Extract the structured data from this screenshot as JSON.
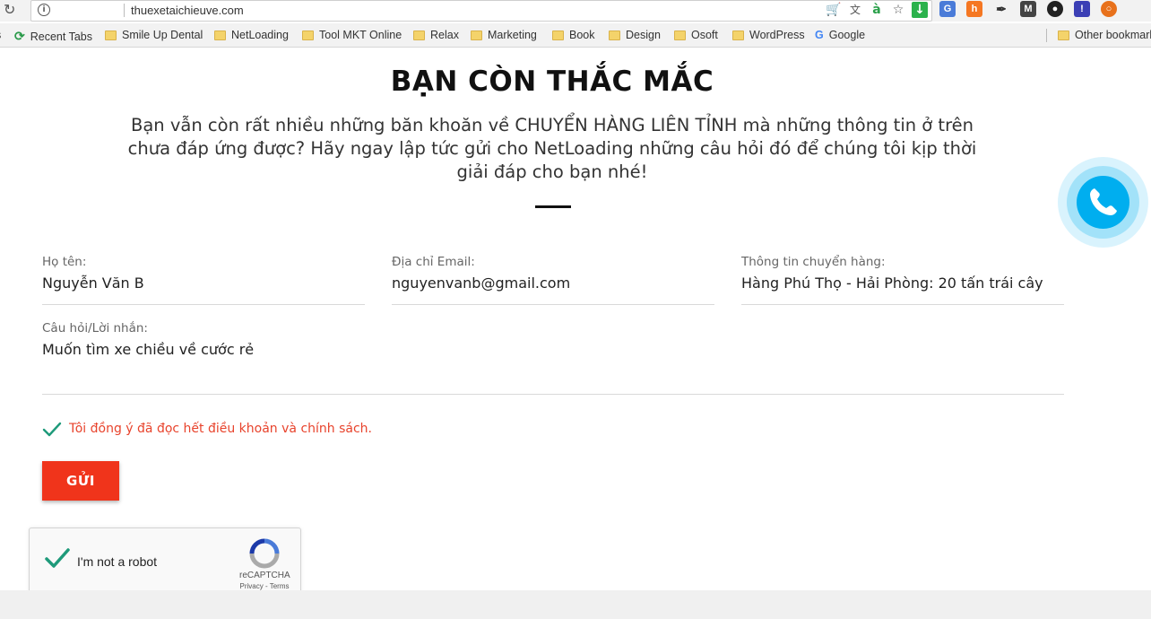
{
  "browser": {
    "url": "thuexetaichieuve.com",
    "bookmarks": [
      {
        "label": "Recent Tabs",
        "icon": "recent-tabs-icon"
      },
      {
        "label": "Smile Up Dental",
        "icon": "folder-icon"
      },
      {
        "label": "NetLoading",
        "icon": "folder-icon"
      },
      {
        "label": "Tool MKT Online",
        "icon": "folder-icon"
      },
      {
        "label": "Relax",
        "icon": "folder-icon"
      },
      {
        "label": "Marketing",
        "icon": "folder-icon"
      },
      {
        "label": "Book",
        "icon": "folder-icon"
      },
      {
        "label": "Design",
        "icon": "folder-icon"
      },
      {
        "label": "Osoft",
        "icon": "folder-icon"
      },
      {
        "label": "WordPress",
        "icon": "folder-icon"
      },
      {
        "label": "Google",
        "icon": "google-icon"
      }
    ],
    "other_bookmarks": "Other bookmarks"
  },
  "page": {
    "title": "BẠN CÒN THẮC MẮC",
    "intro": "Bạn vẫn còn rất nhiều những băn khoăn về CHUYỂN HÀNG LIÊN TỈNH mà những thông tin ở trên chưa đáp ứng được? Hãy ngay lập tức gửi cho NetLoading những câu hỏi đó để chúng tôi kịp thời giải đáp cho bạn nhé!"
  },
  "form": {
    "name": {
      "label": "Họ tên:",
      "value": "Nguyễn Văn B"
    },
    "email": {
      "label": "Địa chỉ Email:",
      "value": "nguyenvanb@gmail.com"
    },
    "shipping": {
      "label": "Thông tin chuyển hàng:",
      "value": "Hàng Phú Thọ - Hải Phòng: 20 tấn trái cây"
    },
    "message": {
      "label": "Câu hỏi/Lời nhắn:",
      "value": "Muốn tìm xe chiều về cước rẻ"
    },
    "consent": "Tôi đồng ý đã đọc hết điều khoản và chính sách.",
    "submit": "GỬI"
  },
  "recaptcha": {
    "label": "I'm not a robot",
    "brand": "reCAPTCHA",
    "links": "Privacy - Terms"
  },
  "colors": {
    "accent_red": "#f0341b",
    "consent_red": "#e8432c",
    "check_green": "#1e9a7a",
    "phone_blue": "#00aeef"
  }
}
